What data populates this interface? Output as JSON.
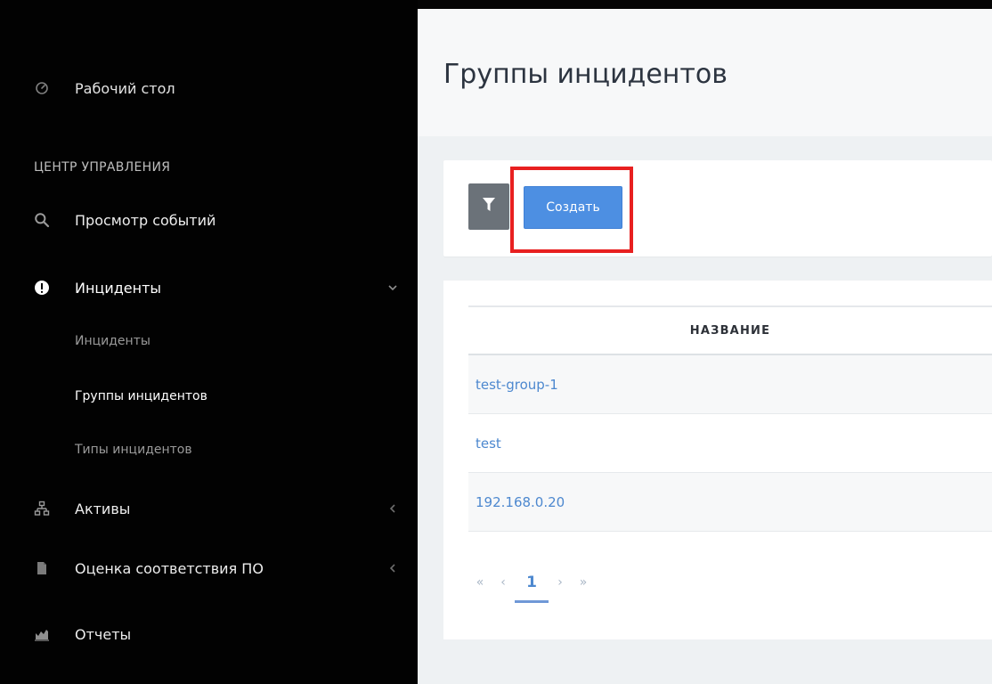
{
  "sidebar": {
    "dashboard_label": "Рабочий стол",
    "section_title": "ЦЕНТР УПРАВЛЕНИЯ",
    "items": [
      {
        "label": "Просмотр событий",
        "icon": "search-icon"
      },
      {
        "label": "Инциденты",
        "icon": "alert-icon"
      },
      {
        "label": "Активы",
        "icon": "network-icon"
      },
      {
        "label": "Оценка соответствия ПО",
        "icon": "document-icon"
      },
      {
        "label": "Отчеты",
        "icon": "chart-icon"
      }
    ],
    "subitems": [
      {
        "label": "Инциденты"
      },
      {
        "label": "Группы инцидентов"
      },
      {
        "label": "Типы инцидентов"
      }
    ]
  },
  "page": {
    "title": "Группы инцидентов"
  },
  "toolbar": {
    "filter_icon": "filter-icon",
    "create_label": "Создать"
  },
  "table": {
    "header": "НАЗВАНИЕ",
    "rows": [
      {
        "name": "test-group-1"
      },
      {
        "name": "test"
      },
      {
        "name": "192.168.0.20"
      }
    ]
  },
  "pagination": {
    "first": "«",
    "prev": "‹",
    "current": "1",
    "next": "›",
    "last": "»"
  },
  "colors": {
    "sidebar_bg": "#020202",
    "accent": "#4d8fe2",
    "link": "#4d88cf",
    "highlight": "#e82020"
  }
}
